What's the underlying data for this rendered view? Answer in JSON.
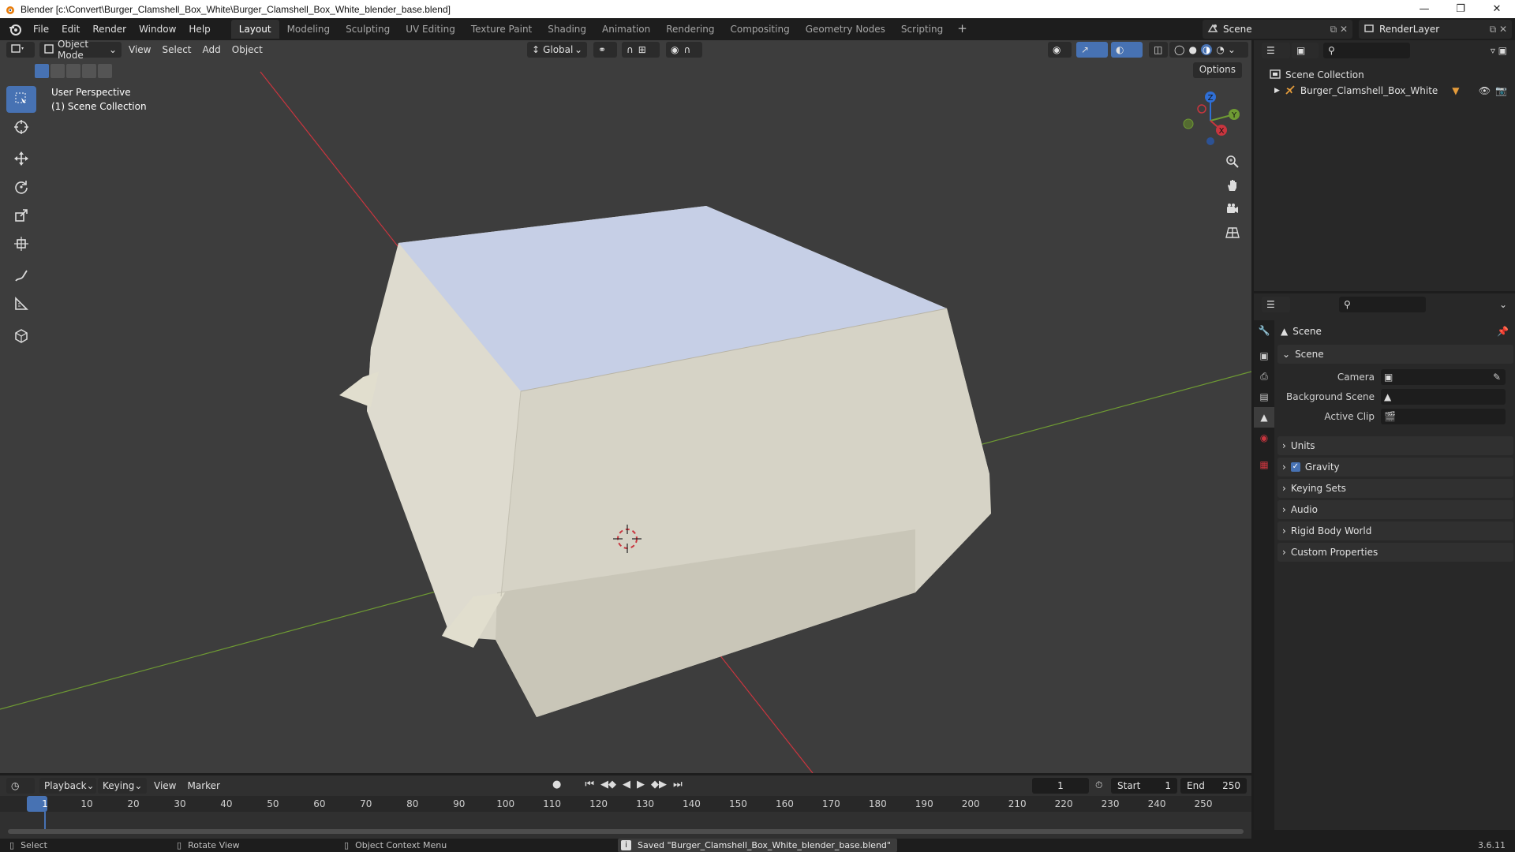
{
  "window": {
    "title": "Blender [c:\\Convert\\Burger_Clamshell_Box_White\\Burger_Clamshell_Box_White_blender_base.blend]"
  },
  "menubar": {
    "items": [
      "File",
      "Edit",
      "Render",
      "Window",
      "Help"
    ],
    "workspaces": [
      "Layout",
      "Modeling",
      "Sculpting",
      "UV Editing",
      "Texture Paint",
      "Shading",
      "Animation",
      "Rendering",
      "Compositing",
      "Geometry Nodes",
      "Scripting"
    ],
    "active_workspace": "Layout",
    "add_tab": "+",
    "scene_name": "Scene",
    "view_layer_name": "RenderLayer"
  },
  "viewport": {
    "mode": "Object Mode",
    "menus": [
      "View",
      "Select",
      "Add",
      "Object"
    ],
    "transform_orientation": "Global",
    "options_label": "Options",
    "perspective_label": "User Perspective",
    "collection_label": "(1) Scene Collection",
    "gizmo_axes": {
      "x": "X",
      "y": "Y",
      "z": "Z"
    },
    "colors": {
      "background": "#3d3d3d",
      "x_axis": "#c9353e",
      "y_axis": "#6e9a33",
      "box_face": "#d9d6c9",
      "box_top": "#c8d0e6"
    }
  },
  "outliner": {
    "root": "Scene Collection",
    "object": "Burger_Clamshell_Box_White"
  },
  "properties": {
    "context_title": "Scene",
    "panel_scene": "Scene",
    "camera_label": "Camera",
    "background_scene_label": "Background Scene",
    "active_clip_label": "Active Clip",
    "panels": [
      "Units",
      "Gravity",
      "Keying Sets",
      "Audio",
      "Rigid Body World",
      "Custom Properties"
    ],
    "gravity_checked": true
  },
  "timeline": {
    "menus": [
      "Playback",
      "Keying",
      "View",
      "Marker"
    ],
    "current_frame": "1",
    "start_label": "Start",
    "start_value": "1",
    "end_label": "End",
    "end_value": "250",
    "ticks": [
      "1",
      "10",
      "20",
      "30",
      "40",
      "50",
      "60",
      "70",
      "80",
      "90",
      "100",
      "110",
      "120",
      "130",
      "140",
      "150",
      "160",
      "170",
      "180",
      "190",
      "200",
      "210",
      "220",
      "230",
      "240",
      "250"
    ]
  },
  "statusbar": {
    "select": "Select",
    "rotate_view": "Rotate View",
    "context_menu": "Object Context Menu",
    "message": "Saved \"Burger_Clamshell_Box_White_blender_base.blend\"",
    "version": "3.6.11"
  }
}
